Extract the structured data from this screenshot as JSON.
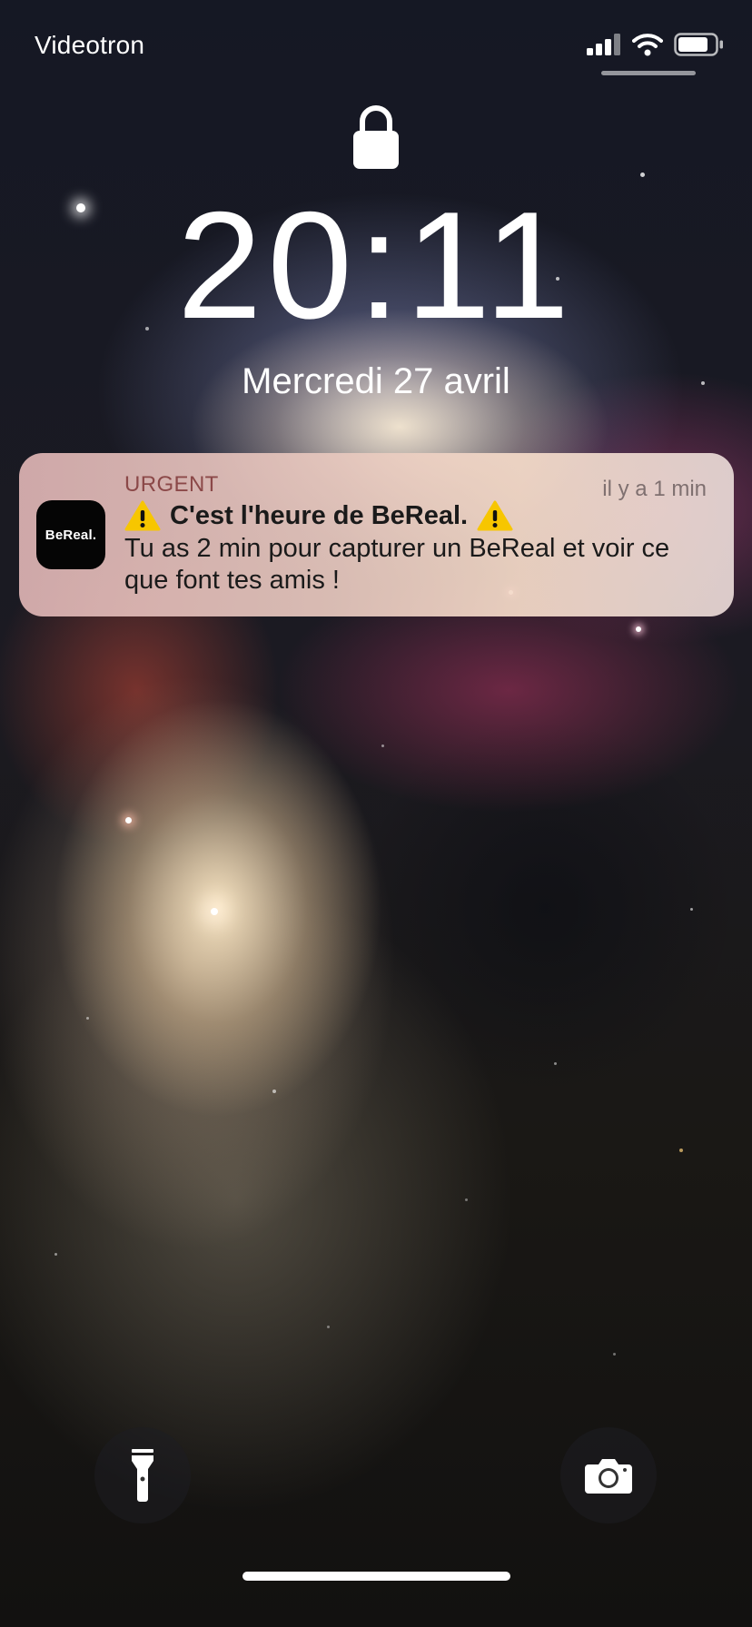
{
  "status_bar": {
    "carrier": "Videotron",
    "signal_icon": "cellular-signal-icon",
    "wifi_icon": "wifi-icon",
    "battery_icon": "battery-icon"
  },
  "lock_screen": {
    "lock_icon": "lock-icon",
    "time": "20:11",
    "date": "Mercredi 27 avril"
  },
  "notification": {
    "app_icon_text": "BeReal.",
    "app_name": "URGENT",
    "time_ago": "il y a 1 min",
    "title": "C'est l'heure de BeReal.",
    "warning_icon": "warning-icon",
    "body": "Tu as 2 min pour capturer un BeReal et voir ce que font tes amis !"
  },
  "quick_actions": {
    "flashlight_icon": "flashlight-icon",
    "camera_icon": "camera-icon"
  },
  "colors": {
    "app_name": "#8b4848",
    "warning": "#f7c600",
    "text": "#1a1a1a"
  }
}
